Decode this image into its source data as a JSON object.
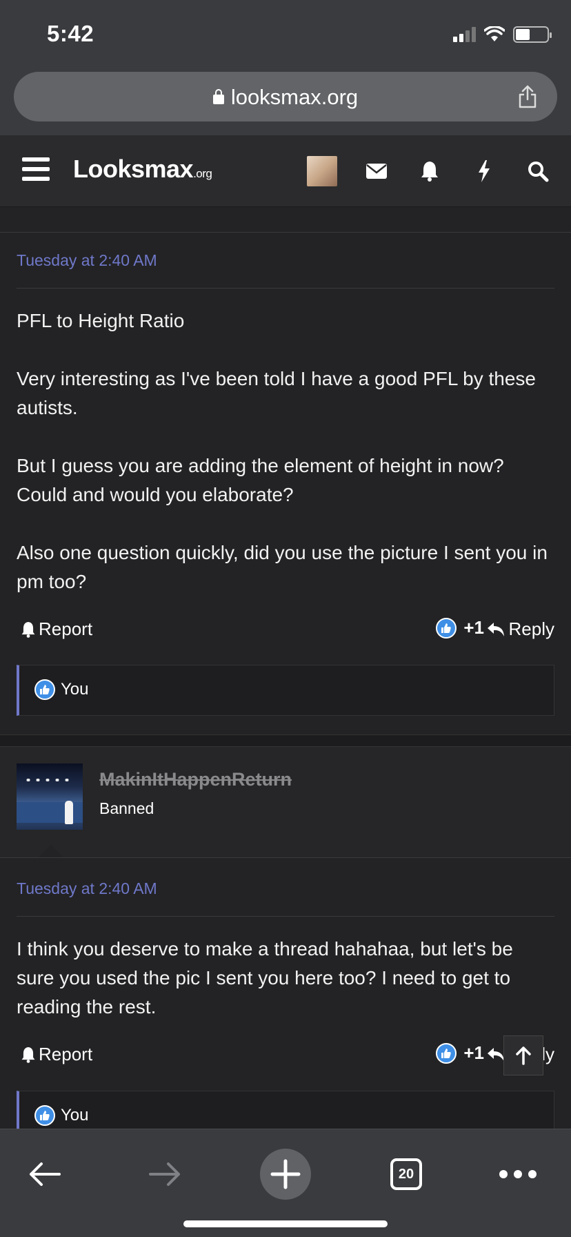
{
  "status_bar": {
    "time": "5:42"
  },
  "browser": {
    "url": "looksmax.org",
    "tab_count": "20"
  },
  "site": {
    "logo_main": "Looksmax",
    "logo_suffix": ".org"
  },
  "posts": [
    {
      "date": "Tuesday at 2:40 AM",
      "paragraphs": [
        "PFL to Height Ratio",
        "Very interesting as I've been told I have a good PFL by these autists.",
        "But I guess you are adding the element of height in now? Could and would you elaborate?",
        "Also one question quickly, did you use the picture I sent you in pm too?"
      ],
      "report_label": "Report",
      "like_count": "+1",
      "reply_label": "Reply",
      "liked_by": "You"
    },
    {
      "author": "MakinItHappenReturn",
      "author_title": "Banned",
      "date": "Tuesday at 2:40 AM",
      "paragraphs": [
        "I think you deserve to make a thread hahahaa, but let's be sure you used the pic I sent you here too? I need to get to reading the rest."
      ],
      "report_label": "Report",
      "like_count": "+1",
      "reply_label": "Reply",
      "liked_by": "You"
    }
  ],
  "colors": {
    "accent": "#6f78c9",
    "like_blue": "#3f8fe6",
    "background": "#232325"
  },
  "icons": [
    "lock-icon",
    "share-icon",
    "menu-icon",
    "mail-icon",
    "bell-icon",
    "lightning-icon",
    "search-icon",
    "thumbs-up-icon",
    "reply-icon",
    "arrow-up-icon",
    "back-icon",
    "forward-icon",
    "plus-icon",
    "more-icon"
  ]
}
